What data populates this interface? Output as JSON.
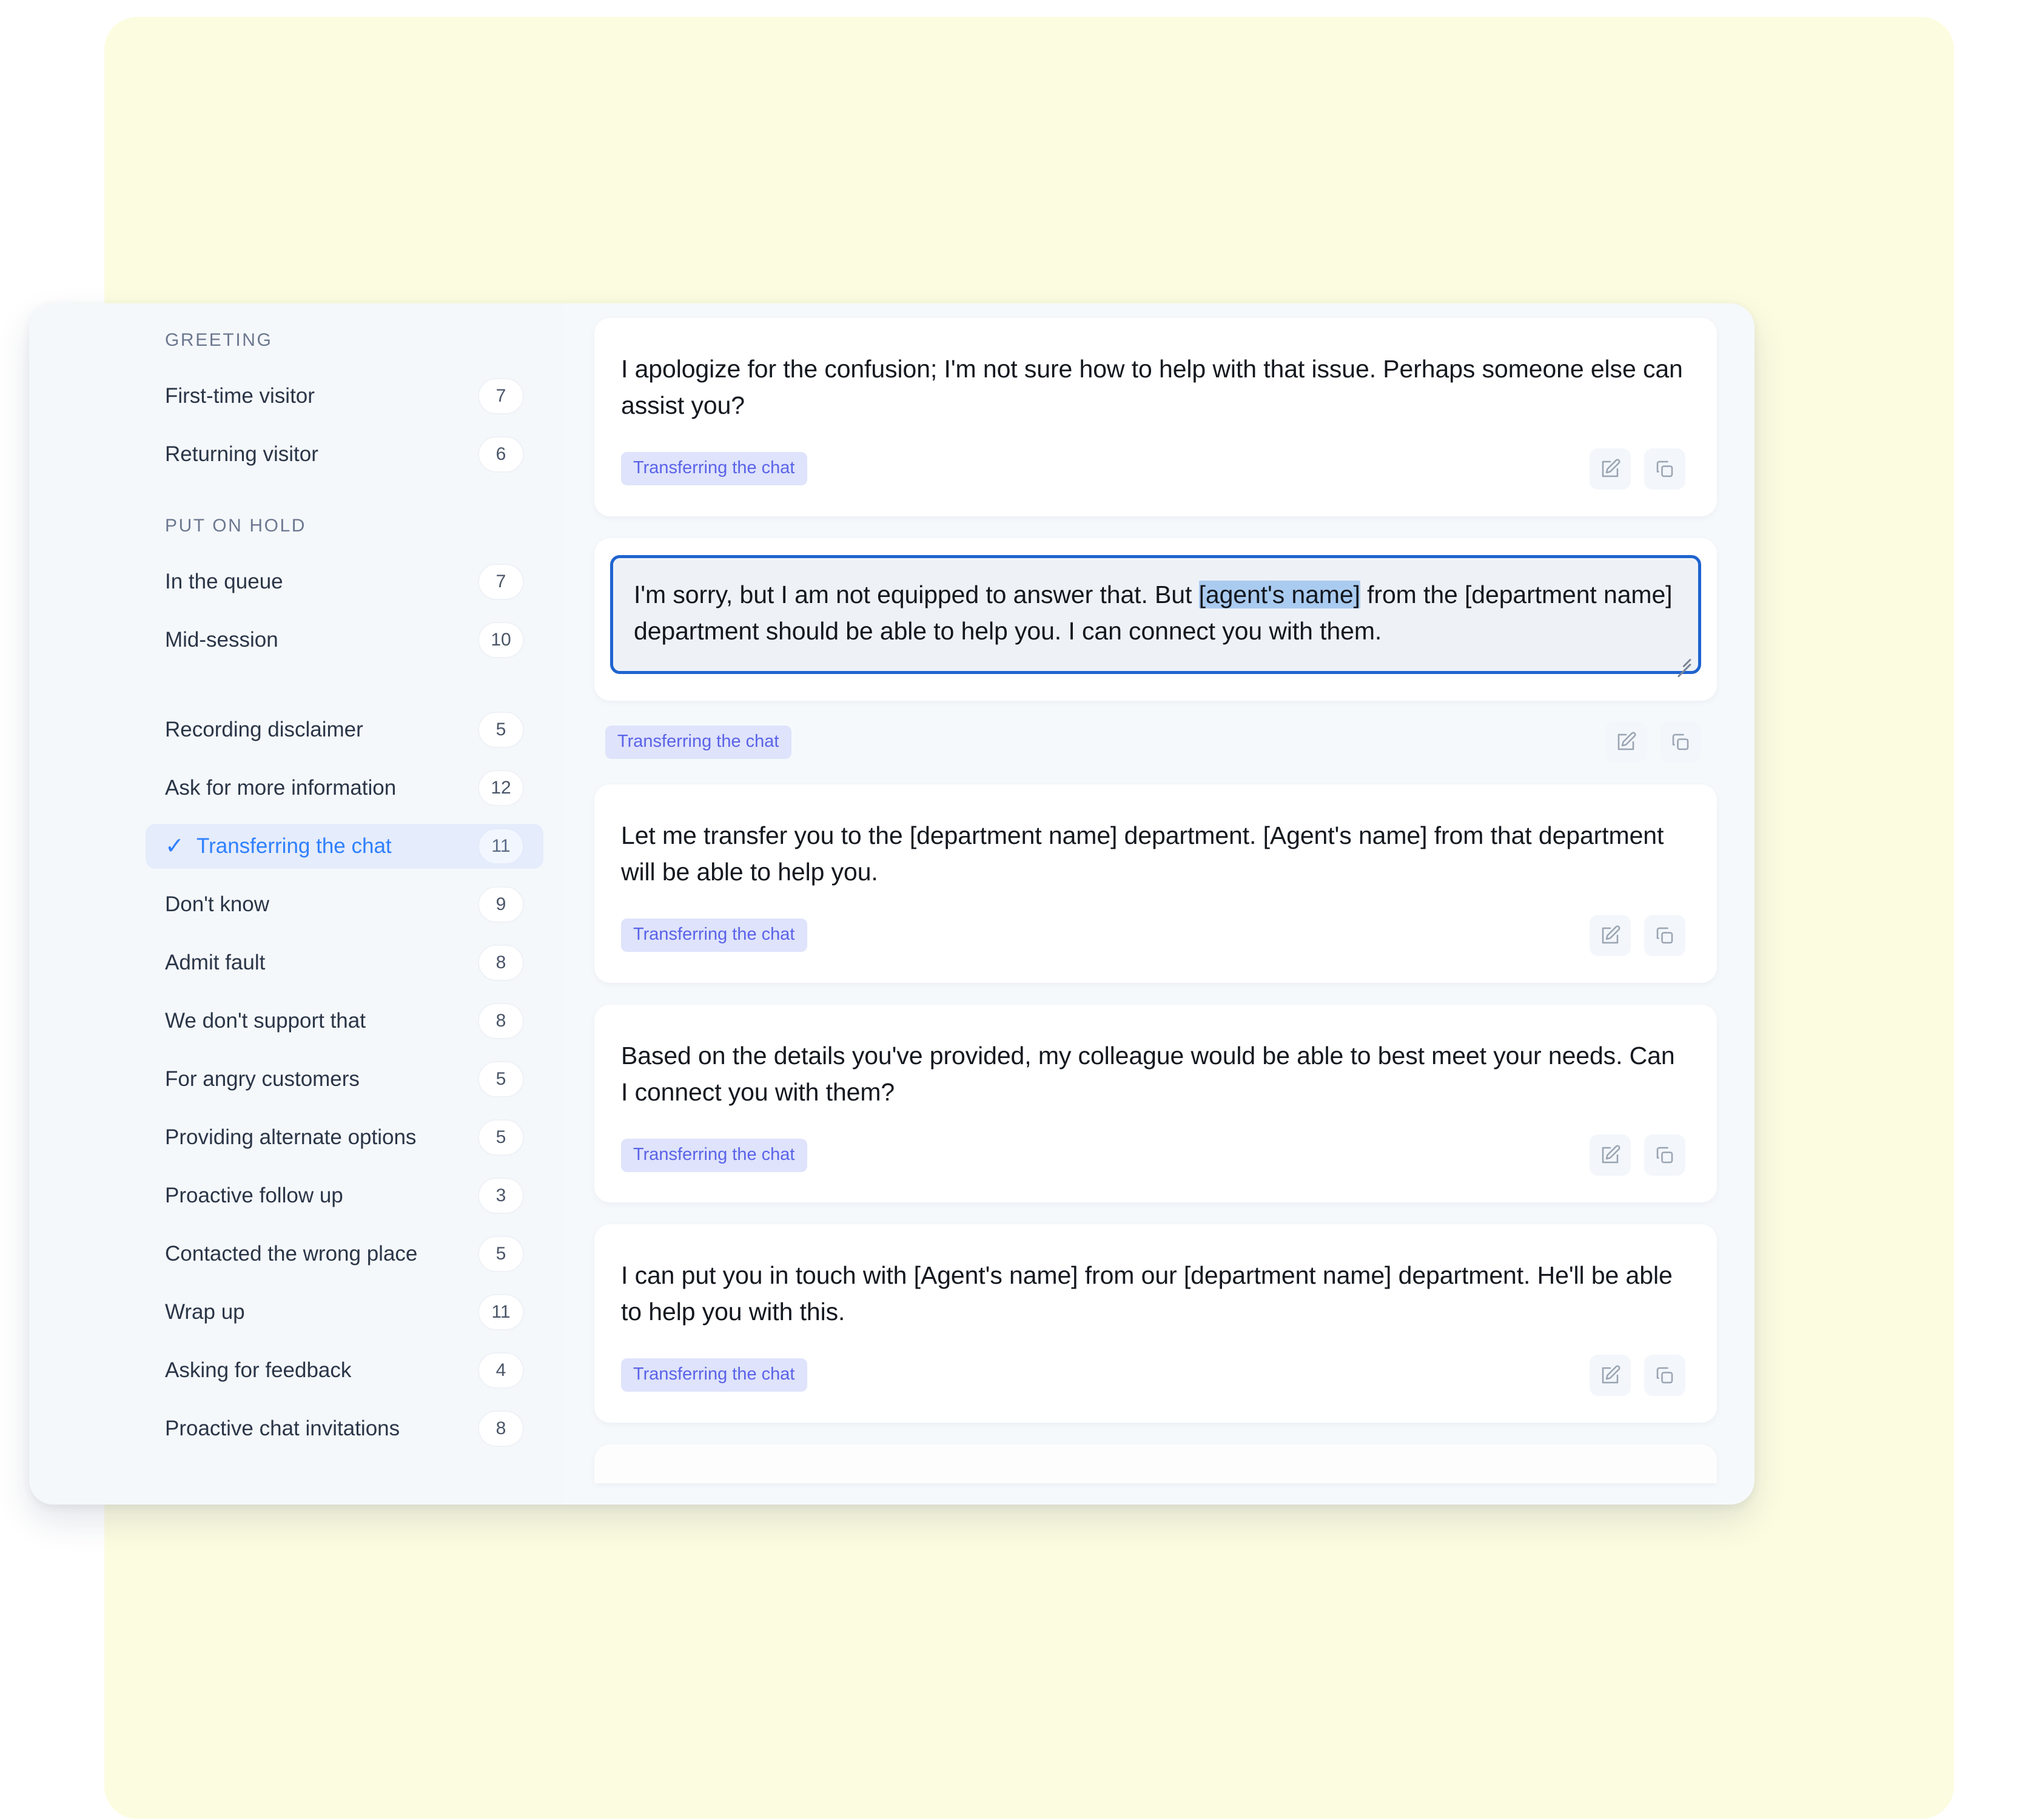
{
  "sidebar": {
    "groups": [
      {
        "title": "GREETING",
        "items": [
          {
            "label": "First-time visitor",
            "count": "7"
          },
          {
            "label": "Returning visitor",
            "count": "6"
          }
        ]
      },
      {
        "title": "PUT ON HOLD",
        "items": [
          {
            "label": "In the queue",
            "count": "7"
          },
          {
            "label": "Mid-session",
            "count": "10"
          }
        ]
      }
    ],
    "items": [
      {
        "label": "Recording disclaimer",
        "count": "5",
        "active": false
      },
      {
        "label": "Ask for more information",
        "count": "12",
        "active": false
      },
      {
        "label": "Transferring the chat",
        "count": "11",
        "active": true
      },
      {
        "label": "Don't know",
        "count": "9",
        "active": false
      },
      {
        "label": "Admit fault",
        "count": "8",
        "active": false
      },
      {
        "label": "We don't support that",
        "count": "8",
        "active": false
      },
      {
        "label": "For angry customers",
        "count": "5",
        "active": false
      },
      {
        "label": "Providing alternate options",
        "count": "5",
        "active": false
      },
      {
        "label": "Proactive follow up",
        "count": "3",
        "active": false
      },
      {
        "label": "Contacted the wrong place",
        "count": "5",
        "active": false
      },
      {
        "label": "Wrap up",
        "count": "11",
        "active": false
      },
      {
        "label": "Asking for feedback",
        "count": "4",
        "active": false
      },
      {
        "label": "Proactive chat invitations",
        "count": "8",
        "active": false
      }
    ],
    "check_glyph": "✓"
  },
  "main": {
    "cards": [
      {
        "text": "I apologize for the confusion; I'm not sure how to help with that issue. Perhaps someone else can assist you?",
        "tag": "Transferring the chat",
        "edit_label": "Edit",
        "copy_label": "Copy"
      },
      {
        "text_before": "I'm sorry, but I am not equipped to answer that. But ",
        "text_selected": "[agent's name]",
        "text_after": " from the [department name] department should be able to help you. I can connect you with them.",
        "tag": "Transferring the chat",
        "edit_label": "Edit",
        "copy_label": "Copy",
        "editing": true
      },
      {
        "text": "Let me transfer you to the [department name] department. [Agent's name] from that department will be able to help you.",
        "tag": "Transferring the chat",
        "edit_label": "Edit",
        "copy_label": "Copy"
      },
      {
        "text": "Based on the details you've provided, my colleague would be able to best meet your needs. Can I connect you with them?",
        "tag": "Transferring the chat",
        "edit_label": "Edit",
        "copy_label": "Copy"
      },
      {
        "text": "I can put you in touch with [Agent's name] from our [department name] department. He'll be able to help you with this.",
        "tag": "Transferring the chat",
        "edit_label": "Edit",
        "copy_label": "Copy"
      }
    ]
  },
  "colors": {
    "accent_blue": "#2f80ff",
    "focus_border": "#1f63cf",
    "tag_bg": "#dfe3fb",
    "tag_text": "#5a63e8",
    "selection_bg": "#aacbf0",
    "backdrop_yellow": "#fcfce0",
    "sidebar_bg": "#f5f8fb",
    "panel_bg": "#f6f9fc"
  }
}
